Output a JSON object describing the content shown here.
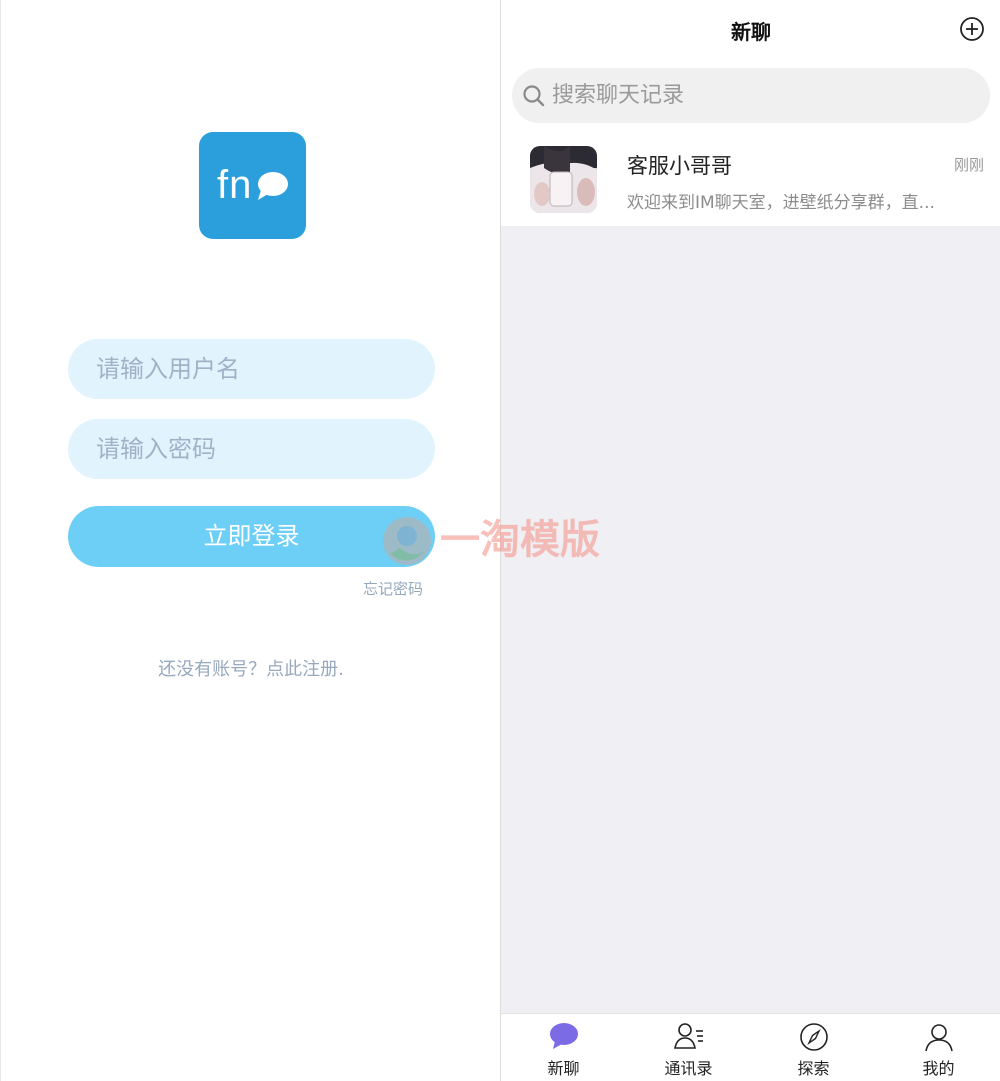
{
  "login": {
    "logo_text": "fn",
    "username_placeholder": "请输入用户名",
    "password_placeholder": "请输入密码",
    "login_button": "立即登录",
    "forgot_password": "忘记密码",
    "register_prompt": "还没有账号？点此注册."
  },
  "watermark": {
    "text": "一淘模版"
  },
  "chat_list": {
    "title": "新聊",
    "search_placeholder": "搜索聊天记录",
    "conversations": [
      {
        "name": "客服小哥哥",
        "time": "刚刚",
        "preview": "欢迎来到IM聊天室，进壁纸分享群，直..."
      }
    ]
  },
  "tabbar": {
    "items": [
      {
        "label": "新聊",
        "icon": "chat-bubble-icon",
        "active": true
      },
      {
        "label": "通讯录",
        "icon": "contacts-icon",
        "active": false
      },
      {
        "label": "探索",
        "icon": "compass-icon",
        "active": false
      },
      {
        "label": "我的",
        "icon": "user-icon",
        "active": false
      }
    ]
  },
  "colors": {
    "brand": "#2b9fdc",
    "input_bg": "#e1f3fc",
    "button": "#6ecff6",
    "active_tab": "#7b6ce6"
  }
}
